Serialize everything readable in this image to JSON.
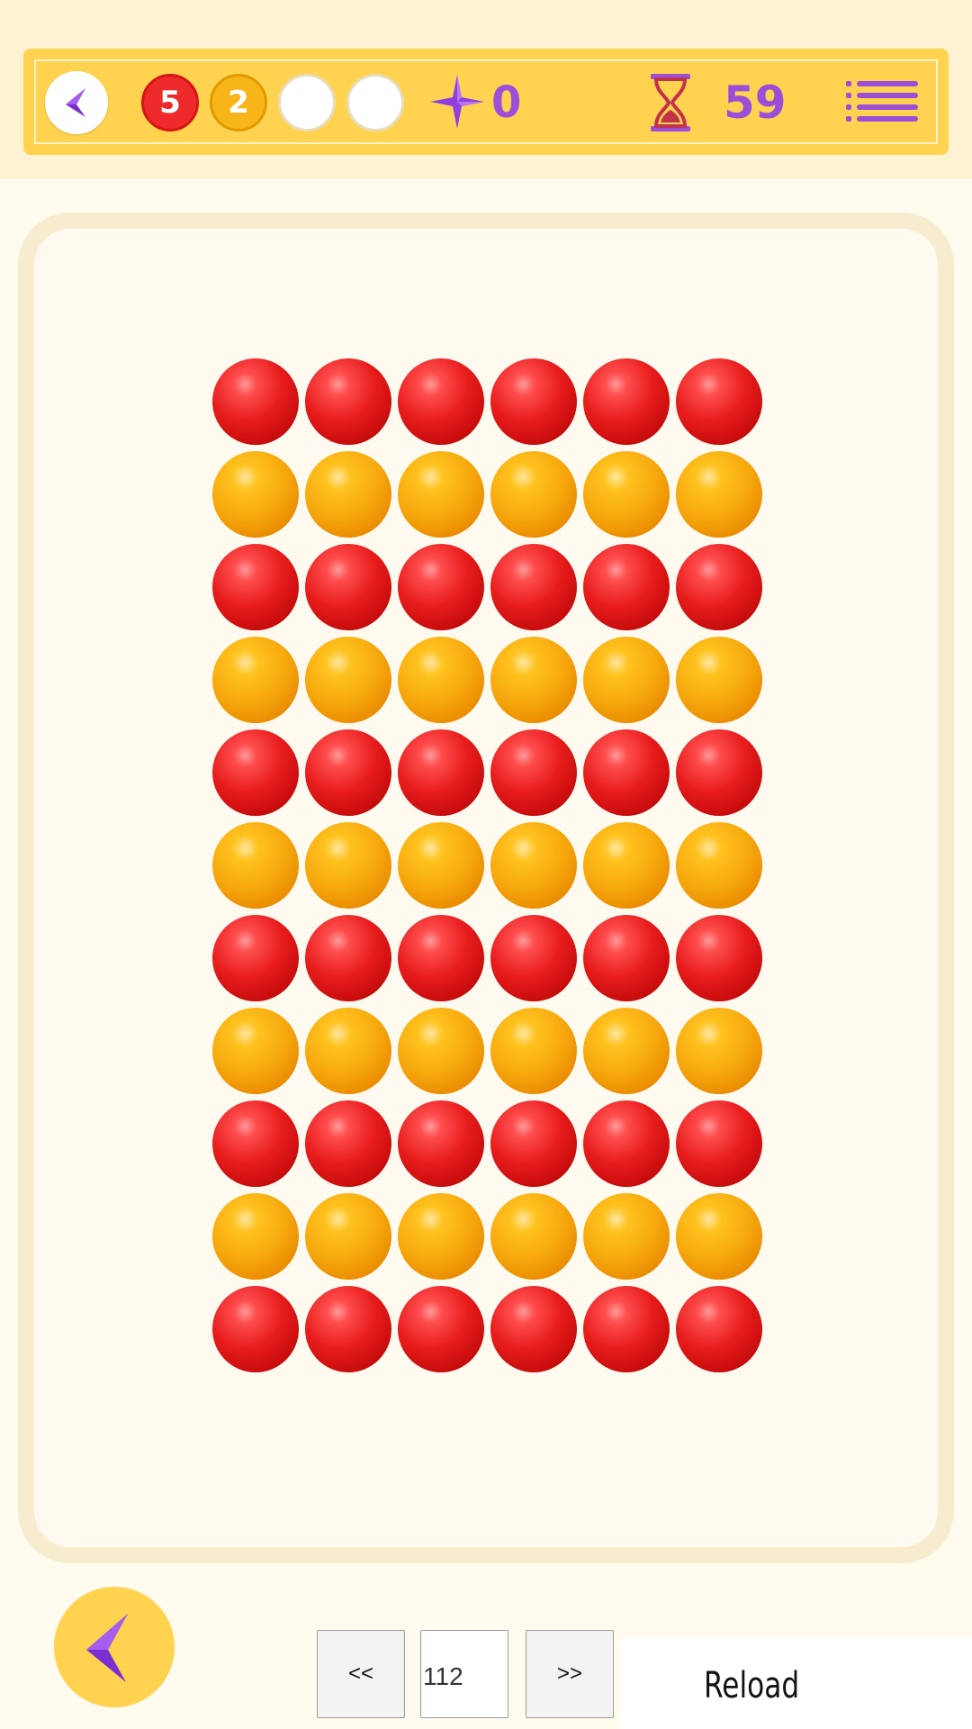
{
  "hud": {
    "back_icon": "chevron-left-icon",
    "score_dots": [
      {
        "color": "red",
        "label": "5"
      },
      {
        "color": "yellow",
        "label": "2"
      },
      {
        "color": "white",
        "label": ""
      },
      {
        "color": "white",
        "label": ""
      }
    ],
    "star_icon": "sparkle-star-icon",
    "star_count": "0",
    "hourglass_icon": "hourglass-icon",
    "timer": "59",
    "menu_icon": "menu-list-icon"
  },
  "board": {
    "columns": 6,
    "rows": [
      "red",
      "orange",
      "red",
      "orange",
      "red",
      "orange",
      "red",
      "orange",
      "red",
      "orange",
      "red"
    ]
  },
  "footer": {
    "back_icon": "chevron-left-icon",
    "prev_label": "<<",
    "level_value": "112",
    "next_label": ">>",
    "reload_label": "Reload"
  },
  "colors": {
    "accent": "#ffd24f",
    "purple": "#9b4fd8",
    "red_ball": "#e81d1d",
    "orange_ball": "#f6a80d",
    "board_border": "#f8ecd0"
  }
}
